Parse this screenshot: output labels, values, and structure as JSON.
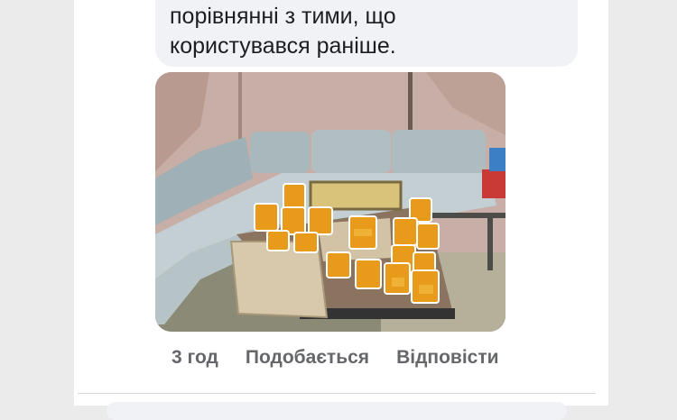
{
  "comment": {
    "text": "порівнянні з тими, що\nкористувався раніше.",
    "image_alt": "honey jars on a table",
    "actions": {
      "time": "3 год",
      "like": "Подобається",
      "reply": "Відповісти"
    }
  }
}
